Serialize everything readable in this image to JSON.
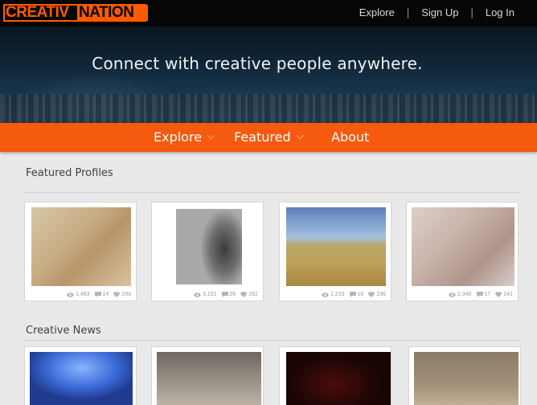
{
  "brand": {
    "logo_text_1": "CREATIV",
    "logo_text_2": "NATION"
  },
  "topnav": {
    "explore": "Explore",
    "signup": "Sign Up",
    "login": "Log In",
    "separator": "|"
  },
  "hero": {
    "title": "Connect with creative people anywhere."
  },
  "mainnav": {
    "explore": "Explore",
    "featured": "Featured",
    "about": "About"
  },
  "featured_profiles": {
    "title": "Featured Profiles",
    "cards": [
      {
        "views": "1,483",
        "comments": "14",
        "likes": "293"
      },
      {
        "views": "3,151",
        "comments": "26",
        "likes": "262"
      },
      {
        "views": "1,233",
        "comments": "18",
        "likes": "236"
      },
      {
        "views": "2,346",
        "comments": "17",
        "likes": "241"
      }
    ]
  },
  "creative_news": {
    "title": "Creative News"
  },
  "colors": {
    "accent": "#f55a0f",
    "topbar": "#060606"
  }
}
